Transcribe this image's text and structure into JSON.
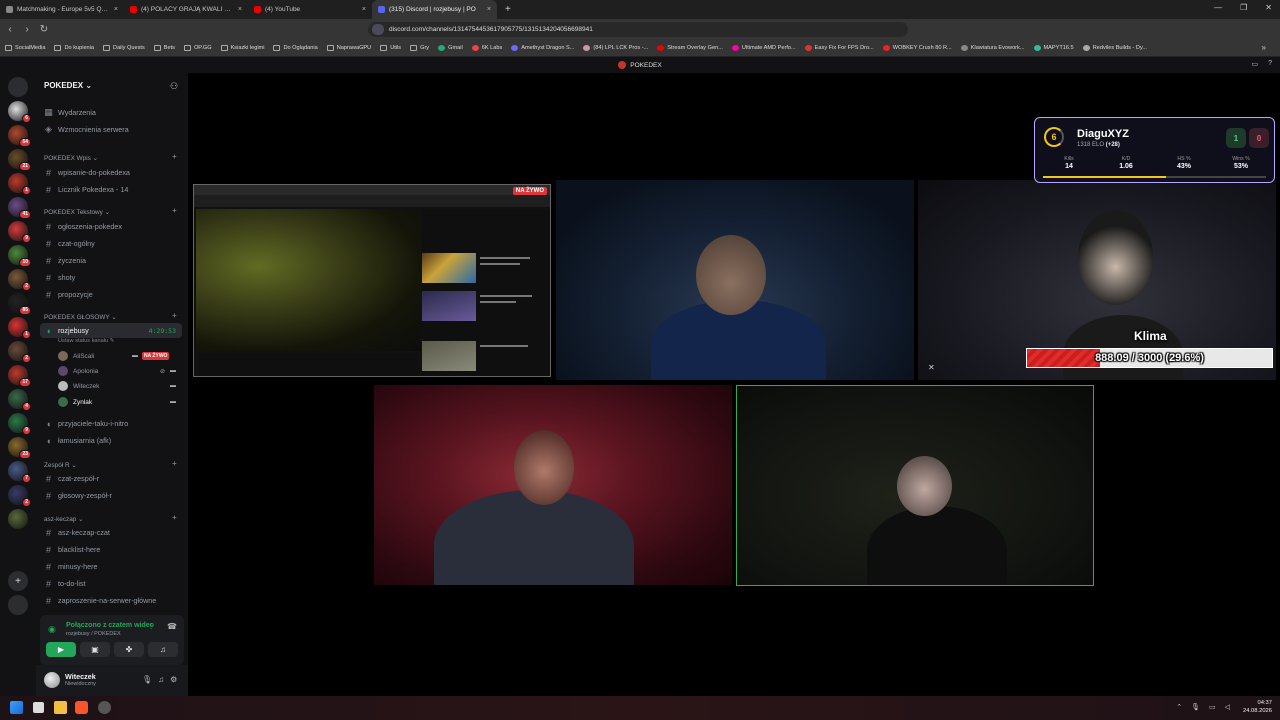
{
  "browser": {
    "tabs": [
      {
        "title": "Matchmaking - Europe 5v5 Queue -",
        "color": "#888888",
        "active": false
      },
      {
        "title": "(4) POLACY GRAJĄ KWALI DO IEM CI",
        "color": "#ff0000",
        "active": false
      },
      {
        "title": "(4) YouTube",
        "color": "#ff0000",
        "active": false
      },
      {
        "title": "(315) Discord | rozjebusy | PO",
        "color": "#5865f2",
        "active": true
      }
    ],
    "url": "discord.com/channels/1314754453617905775/1315134204056698941",
    "bookmarks": [
      {
        "label": "SocialMedia",
        "type": "folder"
      },
      {
        "label": "Do kupienia",
        "type": "folder"
      },
      {
        "label": "Daily Quests",
        "type": "folder"
      },
      {
        "label": "Bets",
        "type": "folder"
      },
      {
        "label": "OP.GG",
        "type": "folder"
      },
      {
        "label": "Ksiazki legimi",
        "type": "folder"
      },
      {
        "label": "Do Oglądania",
        "type": "folder"
      },
      {
        "label": "NaprawaGPU",
        "type": "folder"
      },
      {
        "label": "Utils",
        "type": "folder"
      },
      {
        "label": "Gry",
        "type": "folder"
      },
      {
        "label": "Gmail",
        "type": "site"
      },
      {
        "label": "6K Labs",
        "type": "site"
      },
      {
        "label": "Amethyst Dragon S...",
        "type": "site"
      },
      {
        "label": "(84) LPL LCK Pros -...",
        "type": "site"
      },
      {
        "label": "Stream Overlay Gen...",
        "type": "site"
      },
      {
        "label": "Ultimate AMD Perfo...",
        "type": "site"
      },
      {
        "label": "Easy Fix For FPS Dro...",
        "type": "site"
      },
      {
        "label": "WOBKEY Crush 80 R...",
        "type": "site"
      },
      {
        "label": "Klawiatura Evowork...",
        "type": "site"
      },
      {
        "label": "MAPYT16.5",
        "type": "site"
      },
      {
        "label": "Redviles Builds - Dy...",
        "type": "site"
      }
    ]
  },
  "discord": {
    "top_title": "POKEDEX",
    "server_name": "POKEDEX",
    "rail_badges": [
      "6",
      "54",
      "21",
      "1",
      "41",
      "9",
      "10",
      "2",
      "85",
      "1",
      "2",
      "17",
      "4",
      "9",
      "23",
      "7",
      "2"
    ],
    "top_items": [
      {
        "label": "Wydarzenia",
        "icon": "calendar-icon"
      },
      {
        "label": "Wzmocnienia serwera",
        "icon": "boost-icon"
      }
    ],
    "categories": {
      "wpis": "POKEDEX Wpis",
      "tekstowy": "POKEDEX Tekstowy",
      "glosowy": "POKEDEX GŁOSOWY",
      "zespol": "Zespół R",
      "asz": "asz-keczap"
    },
    "channels_wpis": [
      "wpisanie-do-pokedexa",
      "Licznik Pokedexa - 14"
    ],
    "channels_tekstowy": [
      "ogłoszenia-pokedex",
      "czat-ogólny",
      "życzenia",
      "shoty",
      "propozycje"
    ],
    "voice_channel": {
      "name": "rozjebusy",
      "time": "4:29:53",
      "status": "Ustaw status kanału"
    },
    "voice_users": [
      {
        "name": "AliScali",
        "live": "NA ŻYWO",
        "color": "#7a6a5a"
      },
      {
        "name": "Apolonia",
        "live": "",
        "color": "#5a4a6a"
      },
      {
        "name": "Witeczek",
        "live": "",
        "color": "#bbbbbb"
      },
      {
        "name": "Zynlak",
        "live": "",
        "color": "#3d6b4a"
      }
    ],
    "channels_after_voice": [
      "przyjaciele-taku-i-nitro",
      "łamusiarnia (afk)"
    ],
    "channels_zespol": [
      "czat-zespół-r",
      "głosowy-zespół-r"
    ],
    "channels_asz": [
      "asz-keczap-czat",
      "blacklist-here",
      "minusy-here",
      "to-do-list",
      "zaproszenie-na-serwer-główne"
    ],
    "voice_panel": {
      "title": "Połączono z czatem wideo",
      "subtitle": "rozjebusy / POKEDEX"
    },
    "user": {
      "name": "Witeczek",
      "status": "Niewidoczny"
    }
  },
  "stage": {
    "screen_live": "NA ŻYWO",
    "klima": {
      "name": "Klima",
      "progress_text": "888.09 / 3000 (29.6%)",
      "progress": 0.296
    }
  },
  "faceit": {
    "level": "6",
    "name": "DiaguXYZ",
    "elo": "1318 ELO",
    "elo_change": "(+28)",
    "wins": "1",
    "losses": "0",
    "stats": [
      {
        "label": "Kills",
        "value": "14"
      },
      {
        "label": "K/D",
        "value": "1.06"
      },
      {
        "label": "HS %",
        "value": "43%"
      },
      {
        "label": "Wins %",
        "value": "53%"
      }
    ],
    "accent": "#f5c518"
  },
  "taskbar": {
    "time": "04:37",
    "date": "24.08.2026"
  }
}
